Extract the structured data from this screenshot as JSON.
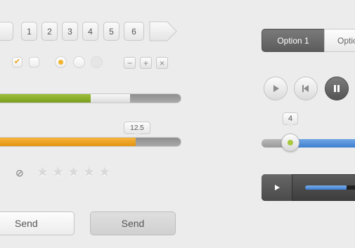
{
  "pagination": {
    "pages": [
      "1",
      "2",
      "3",
      "4",
      "5",
      "6"
    ]
  },
  "checkboxes": [
    {
      "glyph": "✔",
      "checked": true
    },
    {
      "glyph": "",
      "checked": false
    }
  ],
  "icon_buttons": [
    {
      "glyph": "−",
      "icon": "minus-icon"
    },
    {
      "glyph": "+",
      "icon": "plus-icon"
    },
    {
      "glyph": "×",
      "icon": "close-icon"
    }
  ],
  "progress_green": {
    "progress": 0.52,
    "buffered": 0.73
  },
  "progress_orange": {
    "progress": 0.76,
    "value_label": "12.5"
  },
  "rating": {
    "clear_glyph": "⊘",
    "star_glyph": "★",
    "stars": 5
  },
  "buttons": {
    "send_primary": "Send",
    "send_secondary": "Send"
  },
  "segmented": {
    "options": [
      "Option 1",
      "Option"
    ],
    "selected": 0
  },
  "slider": {
    "value_label": "4",
    "position": 0.3
  },
  "player": {
    "progress": 0.74
  },
  "colors": {
    "accent_orange": "#f0a92a",
    "accent_green": "#8cb42c",
    "accent_blue": "#4a86d6"
  }
}
